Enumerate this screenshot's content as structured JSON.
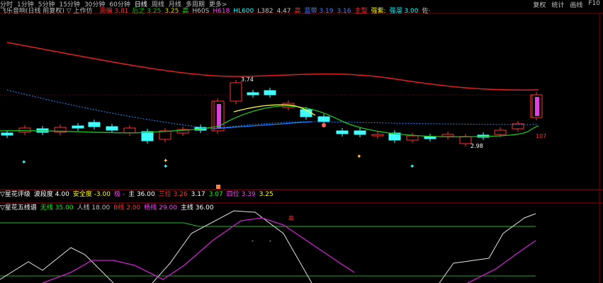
{
  "toolbar": {
    "periods": [
      "分时",
      "1分钟",
      "5分钟",
      "15分钟",
      "30分钟",
      "60分钟",
      "日线",
      "周线",
      "月线",
      "多周期",
      "更多>"
    ],
    "active_period": "日线",
    "right_buttons": [
      "复权",
      "统计",
      "画线",
      "F10"
    ],
    "window_buttons": [
      "—",
      "□",
      "✕"
    ]
  },
  "infobar": {
    "title": "飞乐音响(日线 前复权) ▽ 上作仿",
    "items": [
      {
        "label": "周编",
        "value": "3.81",
        "color": "#ff3030"
      },
      {
        "label": "后之",
        "value": "3.25",
        "color": "#00d000"
      },
      {
        "label": "",
        "value": "3.25",
        "color": "#d0d000"
      },
      {
        "label": "",
        "value": "高",
        "color": "#00ff00"
      },
      {
        "label": "",
        "value": "H60S",
        "color": "#c0c0c0"
      },
      {
        "label": "",
        "value": "H618",
        "color": "#ff40ff"
      },
      {
        "label": "",
        "value": "HL600",
        "color": "#00ffff"
      },
      {
        "label": "",
        "value": "L382",
        "color": "#c0c0c0"
      },
      {
        "label": "",
        "value": "4.47",
        "color": "#c0c0c0"
      },
      {
        "label": "",
        "value": "高",
        "color": "#ff3030"
      },
      {
        "label": "蓝带",
        "value": "3.19",
        "color": "#4080ff"
      },
      {
        "label": "",
        "value": "3.16",
        "color": "#4080ff"
      },
      {
        "label": "",
        "value": "主型",
        "color": "#ff3030"
      },
      {
        "label": "",
        "value": "强紫:",
        "color": "#ffff00"
      },
      {
        "label": "强溜",
        "value": "3.00",
        "color": "#00ffff"
      },
      {
        "label": "",
        "value": "佐·",
        "color": "#c0c0c0"
      }
    ]
  },
  "price_labels": {
    "high_mark": "3.74",
    "low_mark": "2.98",
    "right_mark": "107"
  },
  "indicator1": {
    "title": "▽星花评级",
    "items": [
      {
        "label": "波段度",
        "value": "4.00",
        "color": "#ffffff"
      },
      {
        "label": "安全度",
        "value": "-3.00",
        "color": "#ffff00"
      },
      {
        "label": "极",
        "value": "-",
        "color": "#ff40ff"
      },
      {
        "label": "主",
        "value": "36.00",
        "color": "#ffffff"
      },
      {
        "label": "三位",
        "value": "3.26",
        "color": "#ff3030"
      },
      {
        "label": "",
        "value": "3.17",
        "color": "#ffffff"
      },
      {
        "label": "",
        "value": "3.07",
        "color": "#00ff00"
      },
      {
        "label": "四位",
        "value": "3.39",
        "color": "#ff40ff"
      },
      {
        "label": "",
        "value": "3.25",
        "color": "#ffff00"
      }
    ]
  },
  "indicator2": {
    "title": "▽星花五线谱",
    "items": [
      {
        "label": "无线",
        "value": "35.00",
        "color": "#00ff00"
      },
      {
        "label": "人线",
        "value": "18.00",
        "color": "#c0c0c0"
      },
      {
        "label": "B线",
        "value": "2.00",
        "color": "#ff3030"
      },
      {
        "label": "杨线",
        "value": "29.00",
        "color": "#ff40ff"
      },
      {
        "label": "主线",
        "value": "36.00",
        "color": "#ffffff"
      }
    ],
    "marker": "高"
  },
  "colors": {
    "up": "#ff3030",
    "down": "#40ffff",
    "ma_red": "#e02020",
    "ma_blue": "#1e90ff",
    "ma_green": "#20c020",
    "ma_yellow": "#ffff40"
  }
}
